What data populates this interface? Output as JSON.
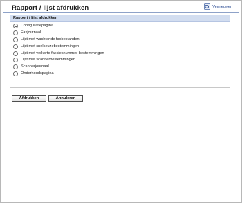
{
  "page": {
    "title": "Rapport / lijst afdrukken",
    "refresh_label": "Vernieuwen"
  },
  "section": {
    "title": "Rapport / lijst afdrukken"
  },
  "options": [
    {
      "label": "Configuratiepagina",
      "checked": true
    },
    {
      "label": "Faxjournaal",
      "checked": false
    },
    {
      "label": "Lijst met wachtende faxbestanden",
      "checked": false
    },
    {
      "label": "Lijst met snelkeuzebestemmingen",
      "checked": false
    },
    {
      "label": "Lijst met verkorte faxkiesnummer-bestemmingen",
      "checked": false
    },
    {
      "label": "Lijst met scannerbestemmingen",
      "checked": false
    },
    {
      "label": "Scannerjournaal",
      "checked": false
    },
    {
      "label": "Onderhoudspagina",
      "checked": false
    }
  ],
  "buttons": {
    "print_label": "Afdrukken",
    "cancel_label": "Annuleren"
  },
  "icons": {
    "refresh": "refresh-icon"
  },
  "colors": {
    "section_header_bg": "#d2ddf0",
    "link": "#1a3d8a"
  }
}
